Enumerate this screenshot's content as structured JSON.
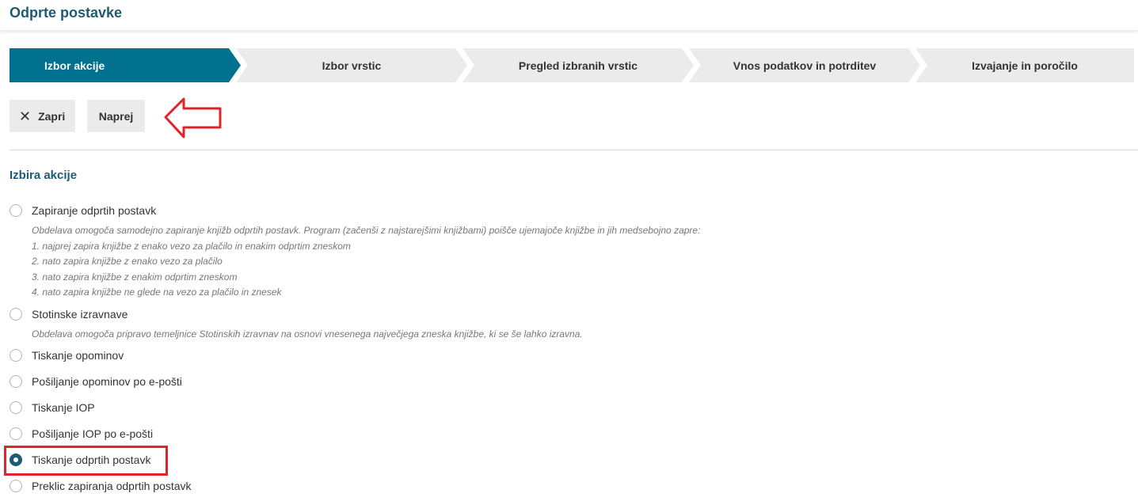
{
  "header": {
    "title": "Odprte postavke"
  },
  "wizard": {
    "steps": [
      {
        "label": "Izbor akcije",
        "active": true
      },
      {
        "label": "Izbor vrstic",
        "active": false
      },
      {
        "label": "Pregled izbranih vrstic",
        "active": false
      },
      {
        "label": "Vnos podatkov in potrditev",
        "active": false
      },
      {
        "label": "Izvajanje in poročilo",
        "active": false
      }
    ]
  },
  "toolbar": {
    "close_label": "Zapri",
    "close_icon": "close-icon",
    "next_label": "Naprej"
  },
  "section": {
    "title": "Izbira akcije"
  },
  "options": [
    {
      "label": "Zapiranje odprtih postavk",
      "checked": false,
      "description": [
        "Obdelava omogoča samodejno zapiranje knjižb odprtih postavk. Program (začenši z najstarejšimi knjižbami) poišče ujemajoče knjižbe in jih medsebojno zapre:",
        "1. najprej zapira knjižbe z enako vezo za plačilo in enakim odprtim zneskom",
        "2. nato zapira knjižbe z enako vezo za plačilo",
        "3. nato zapira knjižbe z enakim odprtim zneskom",
        "4. nato zapira knjižbe ne glede na vezo za plačilo in znesek"
      ]
    },
    {
      "label": "Stotinske izravnave",
      "checked": false,
      "description": [
        "Obdelava omogoča pripravo temeljnice Stotinskih izravnav na osnovi vnesenega največjega zneska knjižbe, ki se še lahko izravna."
      ]
    },
    {
      "label": "Tiskanje opominov",
      "checked": false
    },
    {
      "label": "Pošiljanje opominov po e-pošti",
      "checked": false
    },
    {
      "label": "Tiskanje IOP",
      "checked": false
    },
    {
      "label": "Pošiljanje IOP po e-pošti",
      "checked": false
    },
    {
      "label": "Tiskanje odprtih postavk",
      "checked": true
    },
    {
      "label": "Preklic zapiranja odprtih postavk",
      "checked": false
    }
  ],
  "colors": {
    "accent": "#00718f",
    "title": "#1e5a73",
    "highlight": "#e0242b"
  }
}
